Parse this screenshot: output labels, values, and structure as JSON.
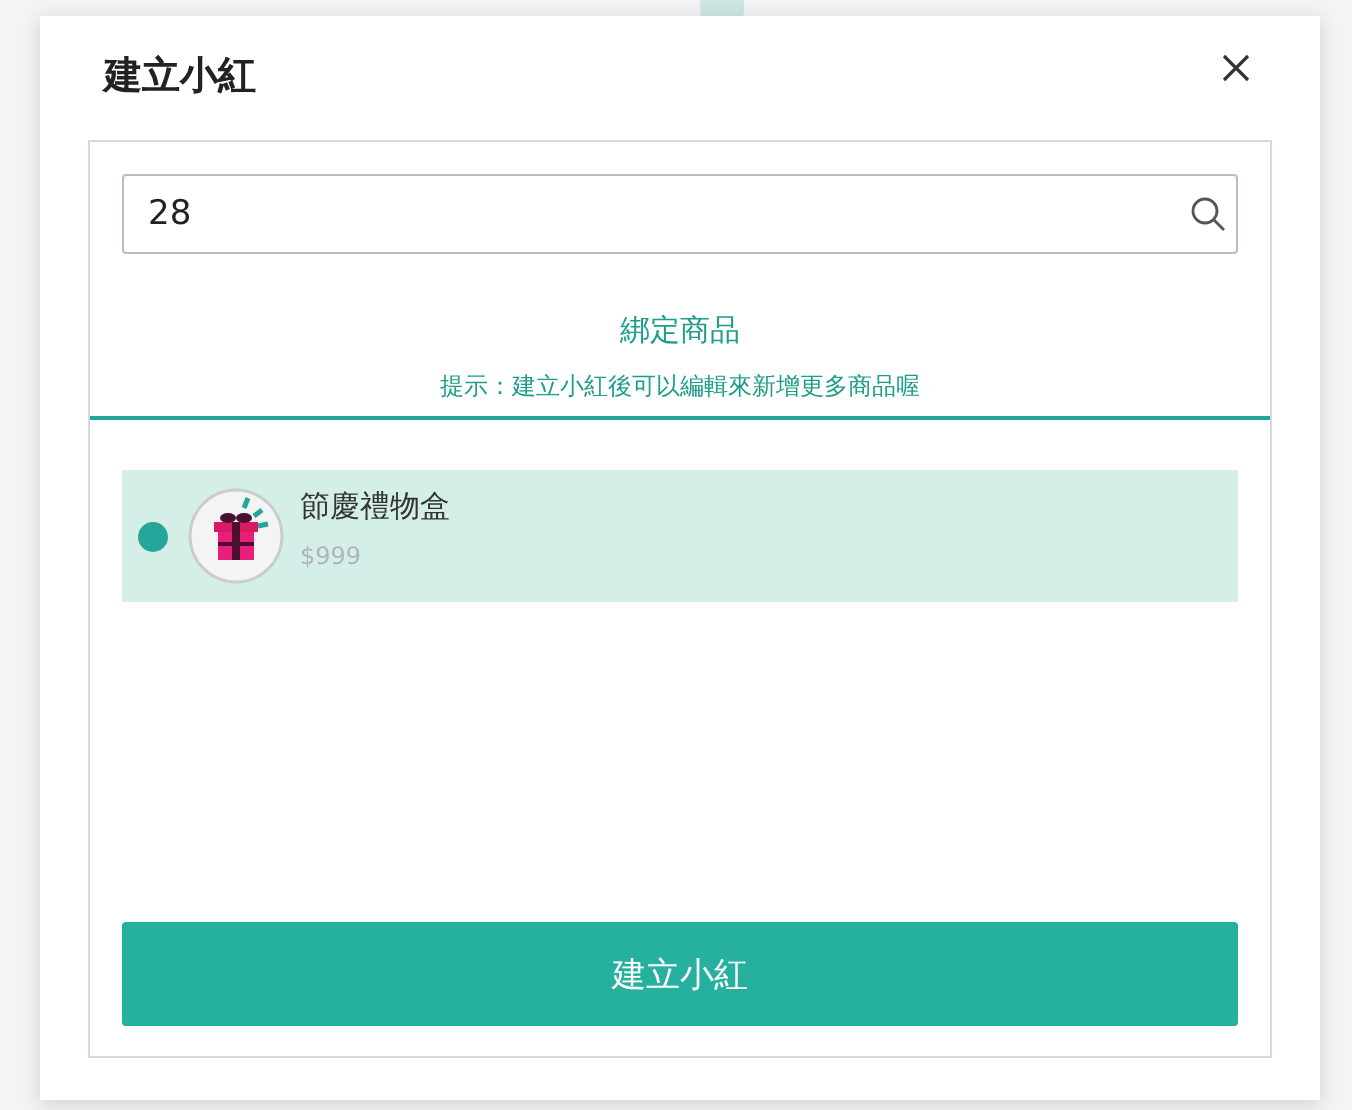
{
  "dialog": {
    "title": "建立小紅"
  },
  "search": {
    "value": "28"
  },
  "section": {
    "title": "綁定商品",
    "hint": "提示：建立小紅後可以編輯來新增更多商品喔"
  },
  "products": [
    {
      "name": "節慶禮物盒",
      "price": "$999",
      "selected": true
    }
  ],
  "submit_button": "建立小紅"
}
